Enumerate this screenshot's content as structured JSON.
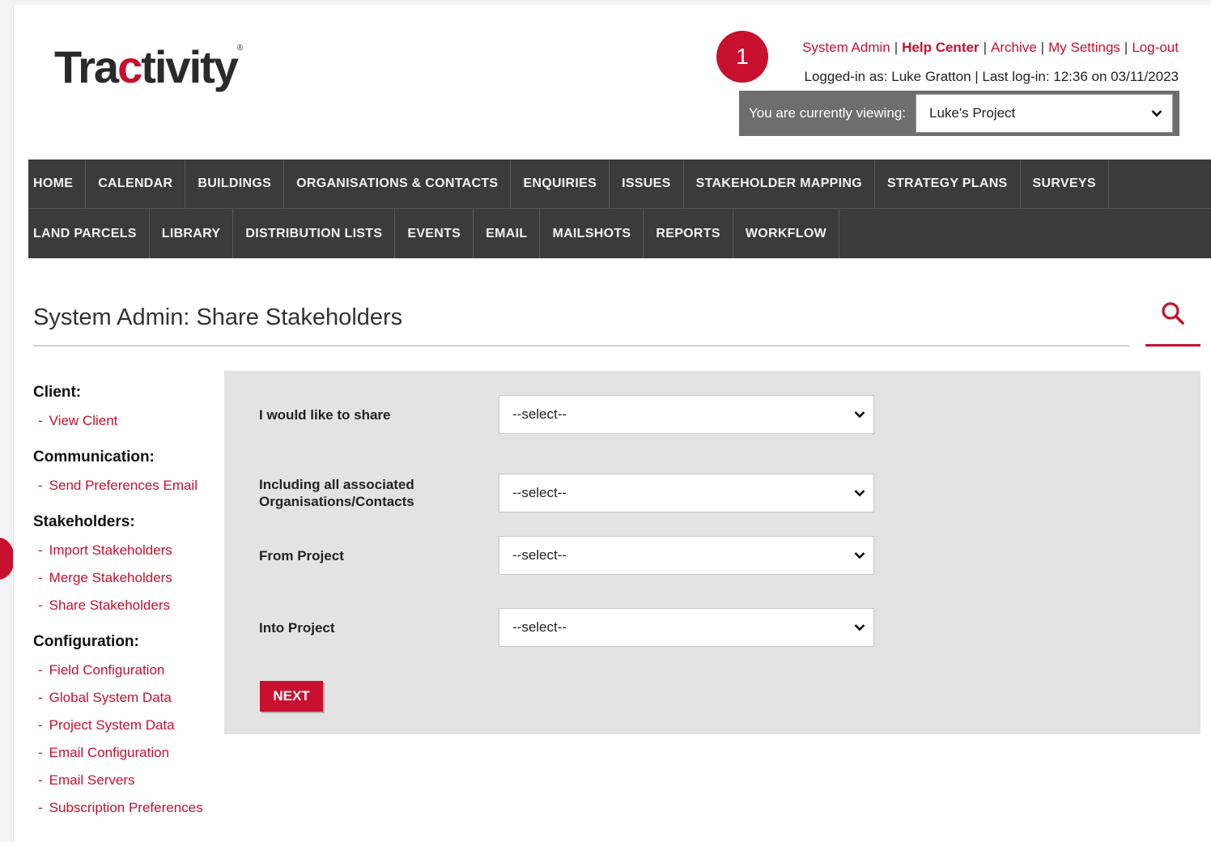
{
  "brand": {
    "logo_pre": "Tra",
    "logo_accent": "c",
    "logo_post": "tivity",
    "logo_mark": "®"
  },
  "step_badge": "1",
  "toplinks": {
    "system_admin": "System Admin",
    "help_center": "Help Center",
    "archive": "Archive",
    "my_settings": "My Settings",
    "logout": "Log-out",
    "separator": "|"
  },
  "login_info": "Logged-in as: Luke Gratton | Last log-in: 12:36 on 03/11/2023",
  "project_viewer": {
    "label": "You are currently viewing:",
    "selected": "Luke's Project"
  },
  "nav": {
    "row1": [
      "HOME",
      "CALENDAR",
      "BUILDINGS",
      "ORGANISATIONS & CONTACTS",
      "ENQUIRIES",
      "ISSUES",
      "STAKEHOLDER MAPPING",
      "STRATEGY PLANS",
      "SURVEYS"
    ],
    "row2": [
      "LAND PARCELS",
      "LIBRARY",
      "DISTRIBUTION LISTS",
      "EVENTS",
      "EMAIL",
      "MAILSHOTS",
      "REPORTS",
      "WORKFLOW"
    ]
  },
  "page_title": "System Admin: Share Stakeholders",
  "sidebar": {
    "client": {
      "heading": "Client:",
      "items": [
        "View Client"
      ]
    },
    "communication": {
      "heading": "Communication:",
      "items": [
        "Send Preferences Email"
      ]
    },
    "stakeholders": {
      "heading": "Stakeholders:",
      "items": [
        "Import Stakeholders",
        "Merge Stakeholders",
        "Share Stakeholders"
      ]
    },
    "configuration": {
      "heading": "Configuration:",
      "items": [
        "Field Configuration",
        "Global System Data",
        "Project System Data",
        "Email Configuration",
        "Email Servers",
        "Subscription Preferences"
      ]
    },
    "dash": "-"
  },
  "form": {
    "share_label": "I would like to share",
    "including_label": "Including all associated Organisations/Contacts",
    "from_label": "From Project",
    "into_label": "Into Project",
    "select_placeholder": "--select--",
    "next_label": "NEXT"
  },
  "colors": {
    "accent": "#c8102e",
    "nav_bg": "#3b3b3b",
    "panel_bg": "#e3e3e3",
    "viewer_bg": "#6e6e6e"
  }
}
